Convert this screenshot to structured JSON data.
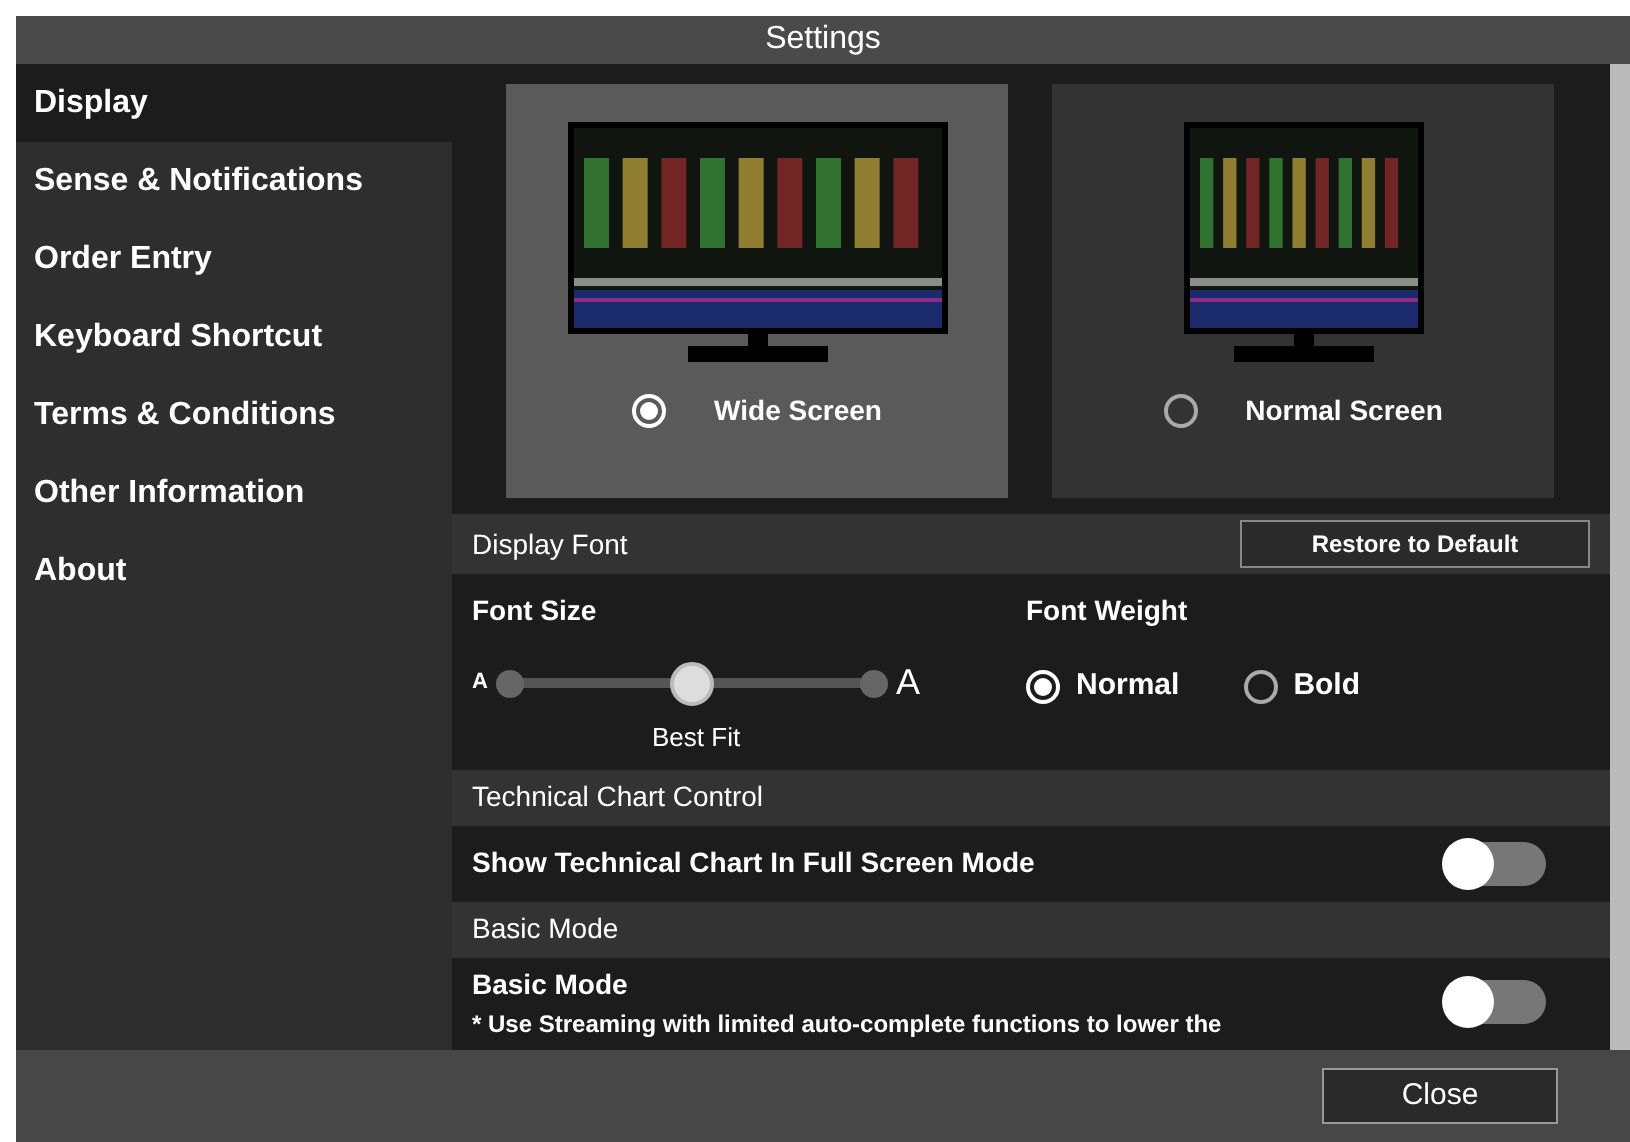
{
  "window": {
    "title": "Settings"
  },
  "sidebar": {
    "items": [
      {
        "label": "Display",
        "selected": true
      },
      {
        "label": "Sense & Notifications",
        "selected": false
      },
      {
        "label": "Order Entry",
        "selected": false
      },
      {
        "label": "Keyboard Shortcut",
        "selected": false
      },
      {
        "label": "Terms & Conditions",
        "selected": false
      },
      {
        "label": "Other Information",
        "selected": false
      },
      {
        "label": "About",
        "selected": false
      }
    ]
  },
  "screen_options": [
    {
      "label": "Wide Screen",
      "selected": true,
      "kind": "wide"
    },
    {
      "label": "Normal Screen",
      "selected": false,
      "kind": "normal"
    }
  ],
  "display_font": {
    "header": "Display Font",
    "restore_button": "Restore to Default",
    "font_size": {
      "label": "Font Size",
      "small_mark": "A",
      "large_mark": "A",
      "level": 0.5,
      "reading": "Best Fit"
    },
    "font_weight": {
      "label": "Font Weight",
      "options": [
        {
          "label": "Normal",
          "selected": true
        },
        {
          "label": "Bold",
          "selected": false
        }
      ]
    }
  },
  "technical_chart": {
    "header": "Technical Chart Control",
    "label": "Show Technical Chart In Full Screen Mode",
    "on": false
  },
  "basic_mode": {
    "header": "Basic Mode",
    "label": "Basic Mode",
    "note": "* Use Streaming with limited auto-complete functions to lower the",
    "on": false
  },
  "footer": {
    "close_button": "Close"
  }
}
